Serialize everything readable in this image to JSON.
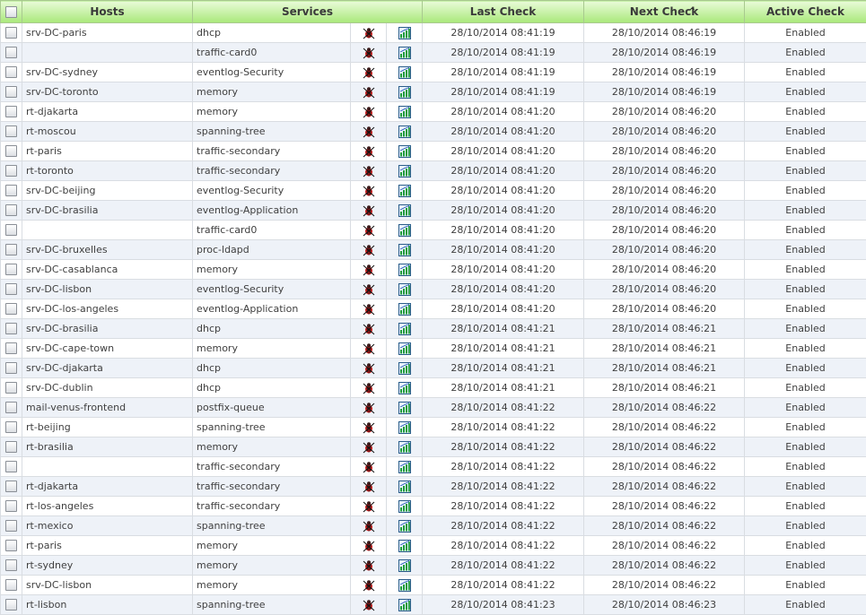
{
  "header": {
    "hosts": "Hosts",
    "services": "Services",
    "last_check": "Last Check",
    "next_check": "Next Check",
    "active_check": "Active Check"
  },
  "icons": {
    "schedule": "bug-schedule-icon",
    "graph": "performance-graph-icon"
  },
  "rows": [
    {
      "host": "srv-DC-paris",
      "service": "dhcp",
      "last": "28/10/2014 08:41:19",
      "next": "28/10/2014 08:46:19",
      "active": "Enabled"
    },
    {
      "host": "",
      "service": "traffic-card0",
      "last": "28/10/2014 08:41:19",
      "next": "28/10/2014 08:46:19",
      "active": "Enabled"
    },
    {
      "host": "srv-DC-sydney",
      "service": "eventlog-Security",
      "last": "28/10/2014 08:41:19",
      "next": "28/10/2014 08:46:19",
      "active": "Enabled"
    },
    {
      "host": "srv-DC-toronto",
      "service": "memory",
      "last": "28/10/2014 08:41:19",
      "next": "28/10/2014 08:46:19",
      "active": "Enabled"
    },
    {
      "host": "rt-djakarta",
      "service": "memory",
      "last": "28/10/2014 08:41:20",
      "next": "28/10/2014 08:46:20",
      "active": "Enabled"
    },
    {
      "host": "rt-moscou",
      "service": "spanning-tree",
      "last": "28/10/2014 08:41:20",
      "next": "28/10/2014 08:46:20",
      "active": "Enabled"
    },
    {
      "host": "rt-paris",
      "service": "traffic-secondary",
      "last": "28/10/2014 08:41:20",
      "next": "28/10/2014 08:46:20",
      "active": "Enabled"
    },
    {
      "host": "rt-toronto",
      "service": "traffic-secondary",
      "last": "28/10/2014 08:41:20",
      "next": "28/10/2014 08:46:20",
      "active": "Enabled"
    },
    {
      "host": "srv-DC-beijing",
      "service": "eventlog-Security",
      "last": "28/10/2014 08:41:20",
      "next": "28/10/2014 08:46:20",
      "active": "Enabled"
    },
    {
      "host": "srv-DC-brasilia",
      "service": "eventlog-Application",
      "last": "28/10/2014 08:41:20",
      "next": "28/10/2014 08:46:20",
      "active": "Enabled"
    },
    {
      "host": "",
      "service": "traffic-card0",
      "last": "28/10/2014 08:41:20",
      "next": "28/10/2014 08:46:20",
      "active": "Enabled"
    },
    {
      "host": "srv-DC-bruxelles",
      "service": "proc-ldapd",
      "last": "28/10/2014 08:41:20",
      "next": "28/10/2014 08:46:20",
      "active": "Enabled"
    },
    {
      "host": "srv-DC-casablanca",
      "service": "memory",
      "last": "28/10/2014 08:41:20",
      "next": "28/10/2014 08:46:20",
      "active": "Enabled"
    },
    {
      "host": "srv-DC-lisbon",
      "service": "eventlog-Security",
      "last": "28/10/2014 08:41:20",
      "next": "28/10/2014 08:46:20",
      "active": "Enabled"
    },
    {
      "host": "srv-DC-los-angeles",
      "service": "eventlog-Application",
      "last": "28/10/2014 08:41:20",
      "next": "28/10/2014 08:46:20",
      "active": "Enabled"
    },
    {
      "host": "srv-DC-brasilia",
      "service": "dhcp",
      "last": "28/10/2014 08:41:21",
      "next": "28/10/2014 08:46:21",
      "active": "Enabled"
    },
    {
      "host": "srv-DC-cape-town",
      "service": "memory",
      "last": "28/10/2014 08:41:21",
      "next": "28/10/2014 08:46:21",
      "active": "Enabled"
    },
    {
      "host": "srv-DC-djakarta",
      "service": "dhcp",
      "last": "28/10/2014 08:41:21",
      "next": "28/10/2014 08:46:21",
      "active": "Enabled"
    },
    {
      "host": "srv-DC-dublin",
      "service": "dhcp",
      "last": "28/10/2014 08:41:21",
      "next": "28/10/2014 08:46:21",
      "active": "Enabled"
    },
    {
      "host": "mail-venus-frontend",
      "service": "postfix-queue",
      "last": "28/10/2014 08:41:22",
      "next": "28/10/2014 08:46:22",
      "active": "Enabled"
    },
    {
      "host": "rt-beijing",
      "service": "spanning-tree",
      "last": "28/10/2014 08:41:22",
      "next": "28/10/2014 08:46:22",
      "active": "Enabled"
    },
    {
      "host": "rt-brasilia",
      "service": "memory",
      "last": "28/10/2014 08:41:22",
      "next": "28/10/2014 08:46:22",
      "active": "Enabled"
    },
    {
      "host": "",
      "service": "traffic-secondary",
      "last": "28/10/2014 08:41:22",
      "next": "28/10/2014 08:46:22",
      "active": "Enabled"
    },
    {
      "host": "rt-djakarta",
      "service": "traffic-secondary",
      "last": "28/10/2014 08:41:22",
      "next": "28/10/2014 08:46:22",
      "active": "Enabled"
    },
    {
      "host": "rt-los-angeles",
      "service": "traffic-secondary",
      "last": "28/10/2014 08:41:22",
      "next": "28/10/2014 08:46:22",
      "active": "Enabled"
    },
    {
      "host": "rt-mexico",
      "service": "spanning-tree",
      "last": "28/10/2014 08:41:22",
      "next": "28/10/2014 08:46:22",
      "active": "Enabled"
    },
    {
      "host": "rt-paris",
      "service": "memory",
      "last": "28/10/2014 08:41:22",
      "next": "28/10/2014 08:46:22",
      "active": "Enabled"
    },
    {
      "host": "rt-sydney",
      "service": "memory",
      "last": "28/10/2014 08:41:22",
      "next": "28/10/2014 08:46:22",
      "active": "Enabled"
    },
    {
      "host": "srv-DC-lisbon",
      "service": "memory",
      "last": "28/10/2014 08:41:22",
      "next": "28/10/2014 08:46:22",
      "active": "Enabled"
    },
    {
      "host": "rt-lisbon",
      "service": "spanning-tree",
      "last": "28/10/2014 08:41:23",
      "next": "28/10/2014 08:46:23",
      "active": "Enabled"
    }
  ]
}
